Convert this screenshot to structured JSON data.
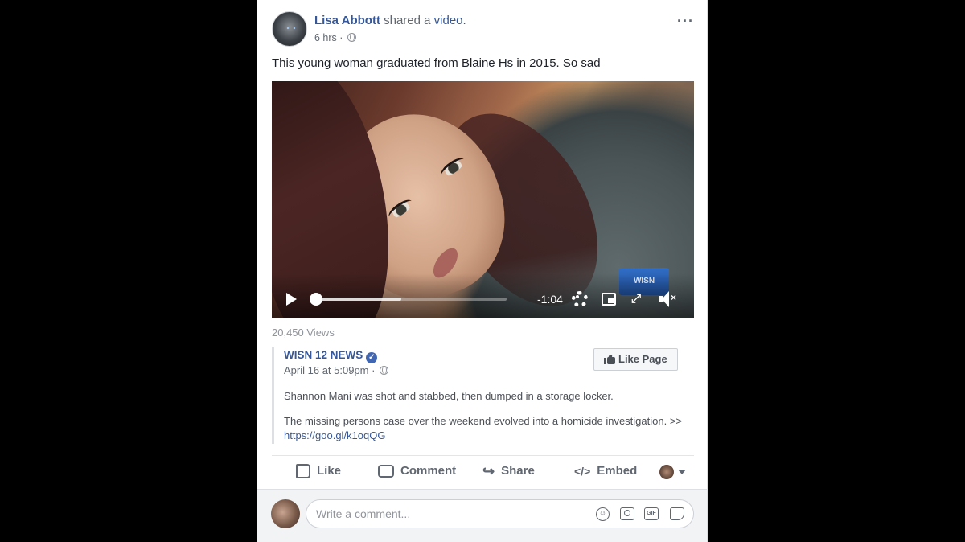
{
  "post": {
    "author": "Lisa Abbott",
    "header_text": " shared a ",
    "header_link": "video.",
    "time": "6 hrs",
    "separator": " · ",
    "more_label": "···",
    "message": "This young woman graduated from Blaine Hs in 2015. So sad"
  },
  "video": {
    "time_remaining": "-1:04",
    "progress_fraction": 0.45,
    "watermark": "WISN",
    "fullscreen_glyph": "⤢",
    "mute_glyph": "×"
  },
  "views": "20,450 Views",
  "shared_post": {
    "page_name": "WISN 12 NEWS",
    "verified_glyph": "✓",
    "date": "April 16 at 5:09pm",
    "separator": " · ",
    "like_page_label": "Like Page",
    "paragraph1": "Shannon Mani was shot and stabbed, then dumped in a storage locker.",
    "paragraph2": "The missing persons case over the weekend evolved into a homicide investigation. >>",
    "link": "https://goo.gl/k1oqQG"
  },
  "actions": {
    "like": "Like",
    "comment": "Comment",
    "share": "Share",
    "share_glyph": "↪",
    "embed": "Embed",
    "embed_glyph": "</>"
  },
  "comment_box": {
    "placeholder": "Write a comment...",
    "smile_glyph": "☺",
    "gif_label": "GIF"
  },
  "icons": [
    "globe-icon",
    "more-icon",
    "play-icon",
    "gear-icon",
    "pip-icon",
    "fullscreen-icon",
    "mute-icon",
    "verified-icon",
    "thumb-icon",
    "like-icon",
    "comment-icon",
    "share-icon",
    "embed-icon",
    "smile-icon",
    "camera-icon",
    "gif-icon",
    "sticker-icon"
  ],
  "colors": {
    "link_blue": "#365899",
    "text_dark": "#1d2129",
    "text_gray": "#606770",
    "background": "#000000",
    "card": "#ffffff"
  }
}
